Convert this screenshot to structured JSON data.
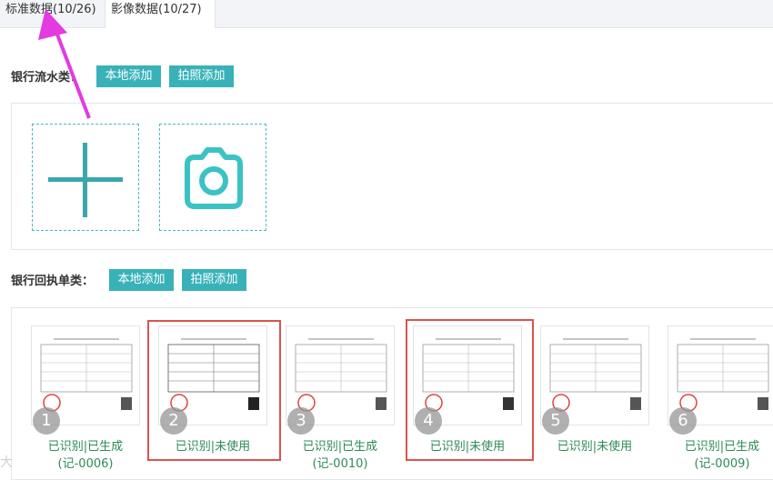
{
  "tabs": [
    {
      "label": "标准数据(10/26)"
    },
    {
      "label": "影像数据(10/27)"
    }
  ],
  "bank_statement": {
    "label": "银行流水类：",
    "local_add": "本地添加",
    "photo_add": "拍照添加"
  },
  "bank_receipt": {
    "label": "银行回执单类：",
    "local_add": "本地添加",
    "photo_add": "拍照添加",
    "items": [
      {
        "num": "1",
        "status": "已识别|已生成",
        "voucher": "(记-0006)"
      },
      {
        "num": "2",
        "status": "已识别|未使用",
        "voucher": ""
      },
      {
        "num": "3",
        "status": "已识别|已生成",
        "voucher": "(记-0010)"
      },
      {
        "num": "4",
        "status": "已识别|未使用",
        "voucher": ""
      },
      {
        "num": "5",
        "status": "已识别|未使用",
        "voucher": ""
      },
      {
        "num": "6",
        "status": "已识别|已生成",
        "voucher": "(记-0009)"
      }
    ]
  },
  "watermark": "大"
}
